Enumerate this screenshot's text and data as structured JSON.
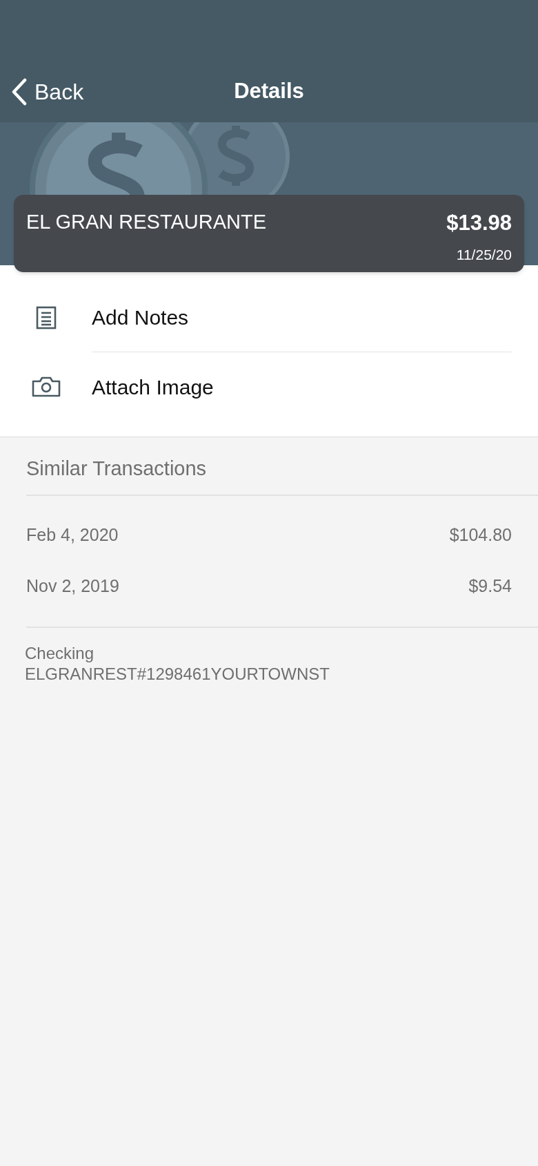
{
  "nav": {
    "back": "Back",
    "title": "Details"
  },
  "transaction": {
    "merchant": "EL GRAN RESTAURANTE",
    "amount": "$13.98",
    "date": "11/25/20"
  },
  "actions": [
    {
      "kind": "notes",
      "label": "Add Notes"
    },
    {
      "kind": "camera",
      "label": "Attach Image"
    }
  ],
  "similar": {
    "title": "Similar Transactions",
    "rows": [
      {
        "date": "Feb 4, 2020",
        "amount": "$104.80"
      },
      {
        "date": "Nov 2, 2019",
        "amount": "$9.54"
      }
    ]
  },
  "account": {
    "name": "Checking",
    "description": "ELGRANREST#1298461YOURTOWNST"
  }
}
